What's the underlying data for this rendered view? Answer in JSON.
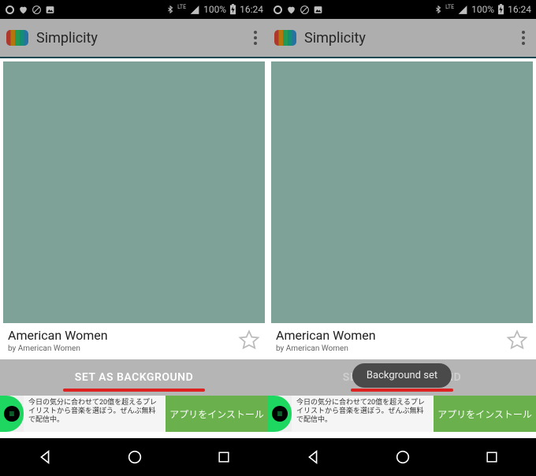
{
  "status": {
    "network_label": "LTE",
    "battery_pct": "100%",
    "time": "16:24"
  },
  "appbar": {
    "title": "Simplicity"
  },
  "card": {
    "title": "American Women",
    "byline": "by American Women"
  },
  "action": {
    "label": "SET AS BACKGROUND"
  },
  "toast": {
    "text": "Background set"
  },
  "ad": {
    "text": "今日の気分に合わせて20億を超えるプレイリストから音楽を選ぼう。ぜんぶ無料で配信中。",
    "cta": "アプリをインストール"
  }
}
